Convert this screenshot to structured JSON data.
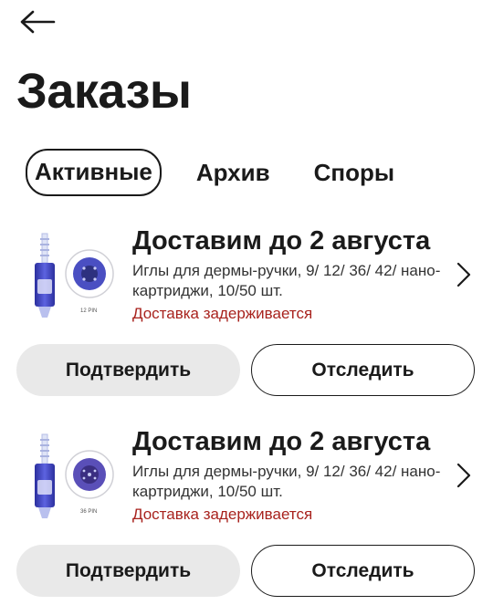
{
  "header": {
    "title": "Заказы"
  },
  "tabs": [
    {
      "label": "Активные",
      "active": true
    },
    {
      "label": "Архив",
      "active": false
    },
    {
      "label": "Споры",
      "active": false
    }
  ],
  "orders": [
    {
      "title": "Доставим до 2 августа",
      "description": "Иглы для дермы-ручки, 9/ 12/ 36/ 42/ нано-картриджи, 10/50 шт.",
      "status": "Доставка задерживается",
      "image_label": "12 PIN",
      "confirm_label": "Подтвердить",
      "track_label": "Отследить"
    },
    {
      "title": "Доставим до 2 августа",
      "description": "Иглы для дермы-ручки, 9/ 12/ 36/ 42/ нано-картриджи, 10/50 шт.",
      "status": "Доставка задерживается",
      "image_label": "36 PIN",
      "confirm_label": "Подтвердить",
      "track_label": "Отследить"
    }
  ],
  "colors": {
    "status": "#a8221d",
    "confirm_bg": "#e9e9e9",
    "text": "#1a1a1a"
  },
  "icons": {
    "back": "arrow-left-icon",
    "chevron": "chevron-right-icon"
  }
}
